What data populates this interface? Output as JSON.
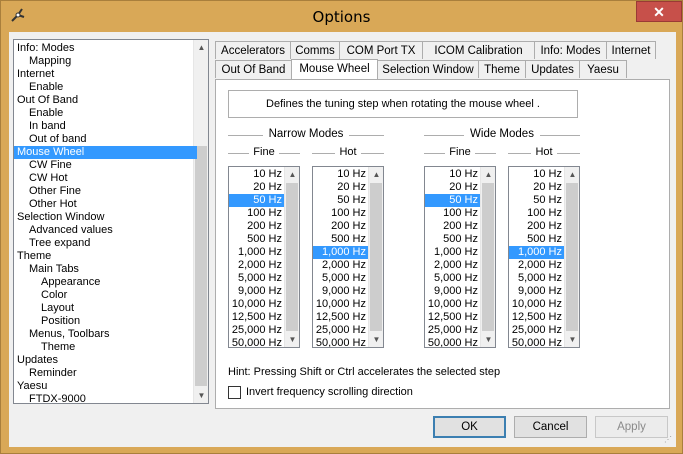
{
  "window": {
    "title": "Options",
    "close_glyph": "✕"
  },
  "tree": {
    "items": [
      {
        "label": "Info: Modes",
        "indent": 0
      },
      {
        "label": "Mapping",
        "indent": 1
      },
      {
        "label": "Internet",
        "indent": 0
      },
      {
        "label": "Enable",
        "indent": 1
      },
      {
        "label": "Out Of Band",
        "indent": 0
      },
      {
        "label": "Enable",
        "indent": 1
      },
      {
        "label": "In band",
        "indent": 1
      },
      {
        "label": "Out of band",
        "indent": 1
      },
      {
        "label": "Mouse Wheel",
        "indent": 0,
        "selected": true
      },
      {
        "label": "CW Fine",
        "indent": 1
      },
      {
        "label": "CW Hot",
        "indent": 1
      },
      {
        "label": "Other Fine",
        "indent": 1
      },
      {
        "label": "Other Hot",
        "indent": 1
      },
      {
        "label": "Selection Window",
        "indent": 0
      },
      {
        "label": "Advanced values",
        "indent": 1
      },
      {
        "label": "Tree expand",
        "indent": 1
      },
      {
        "label": "Theme",
        "indent": 0
      },
      {
        "label": "Main Tabs",
        "indent": 1
      },
      {
        "label": "Appearance",
        "indent": 2
      },
      {
        "label": "Color",
        "indent": 2
      },
      {
        "label": "Layout",
        "indent": 2
      },
      {
        "label": "Position",
        "indent": 2
      },
      {
        "label": "Menus, Toolbars",
        "indent": 1
      },
      {
        "label": "Theme",
        "indent": 2
      },
      {
        "label": "Updates",
        "indent": 0
      },
      {
        "label": "Reminder",
        "indent": 1
      },
      {
        "label": "Yaesu",
        "indent": 0
      },
      {
        "label": "FTDX-9000",
        "indent": 1
      }
    ]
  },
  "tabs": {
    "row1": [
      "Accelerators",
      "Comms",
      "COM Port TX",
      "ICOM Calibration",
      "Info: Modes",
      "Internet"
    ],
    "row2": [
      "Out Of Band",
      "Mouse Wheel",
      "Selection Window",
      "Theme",
      "Updates",
      "Yaesu"
    ],
    "active": "Mouse Wheel"
  },
  "panel": {
    "description": "Defines the tuning step when rotating the mouse wheel .",
    "narrow_title": "Narrow Modes",
    "wide_title": "Wide Modes",
    "fine_label": "Fine",
    "hot_label": "Hot",
    "steps": [
      "10 Hz",
      "20 Hz",
      "50 Hz",
      "100 Hz",
      "200 Hz",
      "500 Hz",
      "1,000 Hz",
      "2,000 Hz",
      "5,000 Hz",
      "9,000 Hz",
      "10,000 Hz",
      "12,500 Hz",
      "25,000 Hz",
      "50,000 Hz"
    ],
    "lists": [
      {
        "group": "narrow",
        "kind": "fine",
        "selected": "50 Hz"
      },
      {
        "group": "narrow",
        "kind": "hot",
        "selected": "1,000 Hz"
      },
      {
        "group": "wide",
        "kind": "fine",
        "selected": "50 Hz"
      },
      {
        "group": "wide",
        "kind": "hot",
        "selected": "1,000 Hz"
      }
    ],
    "hint": "Hint: Pressing Shift or Ctrl accelerates the selected step",
    "invert_label": "Invert frequency scrolling direction",
    "invert_checked": false
  },
  "buttons": {
    "ok": "OK",
    "cancel": "Cancel",
    "apply": "Apply"
  },
  "colors": {
    "titlebar": "#d9a857",
    "selection": "#3399ff",
    "close": "#c7504a"
  }
}
